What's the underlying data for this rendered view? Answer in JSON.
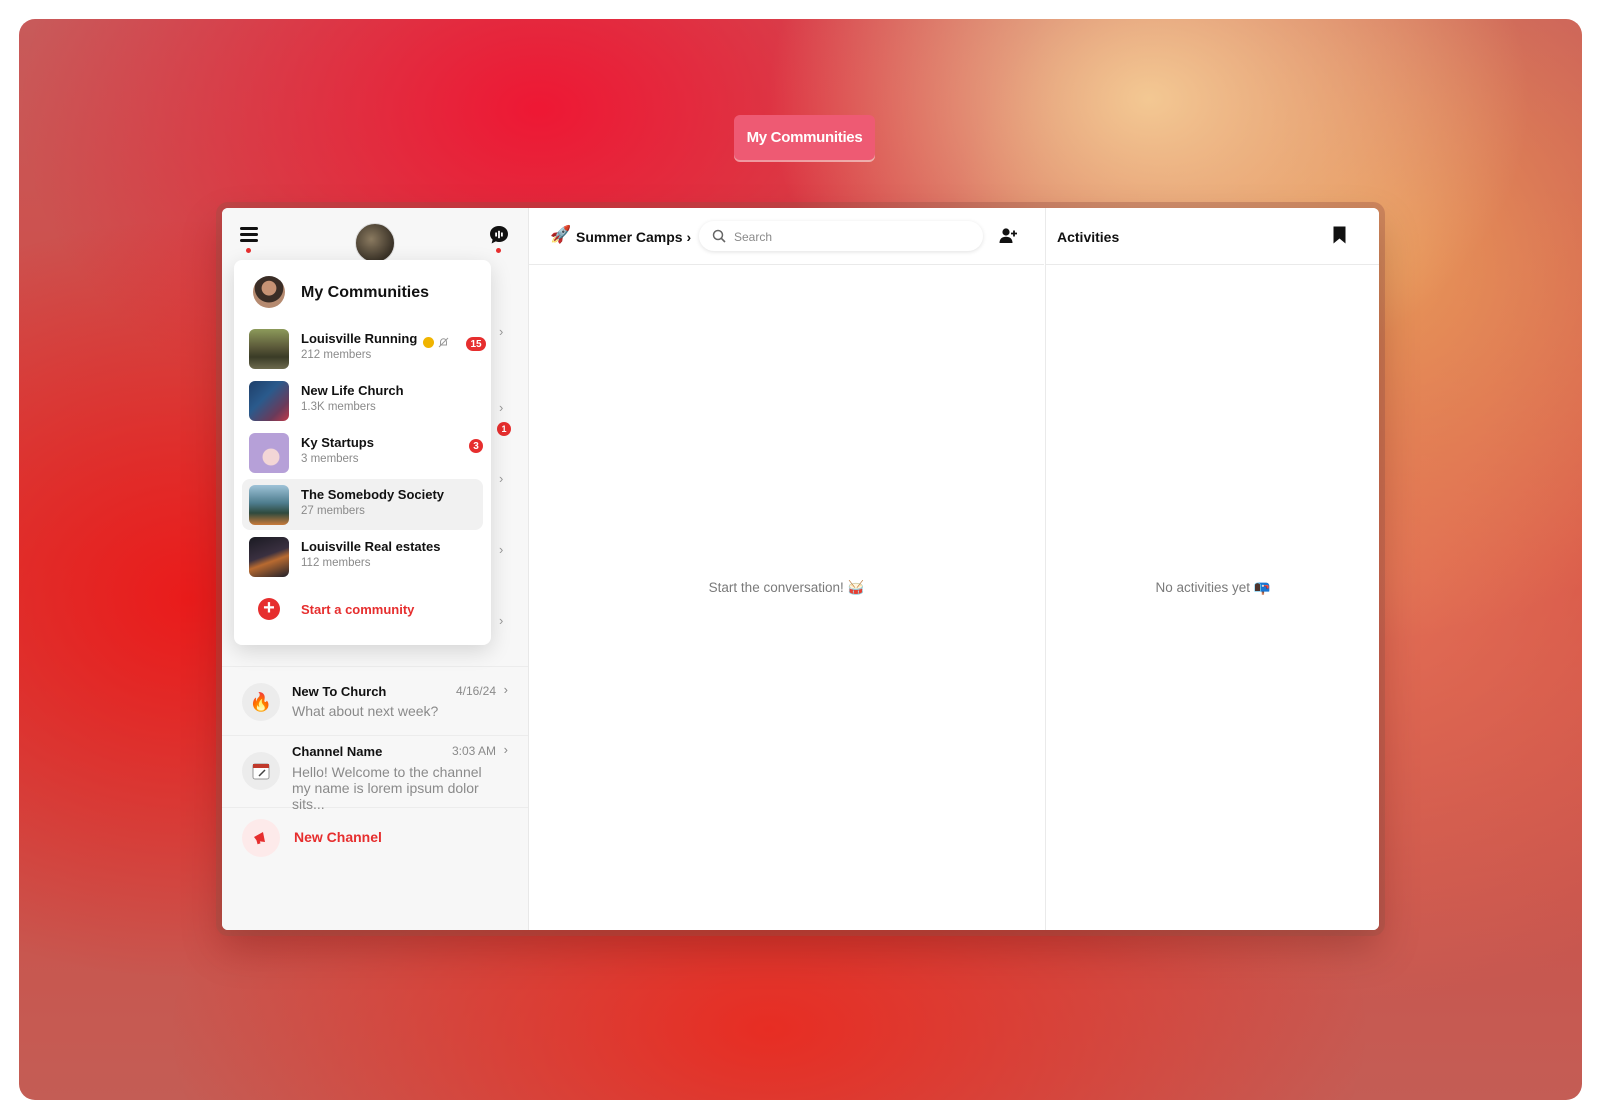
{
  "top_button": {
    "label": "My Communities"
  },
  "sidebar": {
    "channels": [
      {
        "title": "New To Church",
        "time": "4/16/24",
        "preview": "What about next week?",
        "icon": "fire-emoji"
      },
      {
        "title": "Channel Name",
        "time": "3:03 AM",
        "preview": "Hello! Welcome to the channel my name is lorem ipsum dolor sits...",
        "icon": "calendar-icon"
      }
    ],
    "hidden_badge": "1",
    "new_channel_label": "New Channel"
  },
  "dropdown": {
    "title": "My Communities",
    "communities": [
      {
        "name": "Louisville Running",
        "members": "212 members",
        "badge": "15",
        "verified": true,
        "muted": true
      },
      {
        "name": "New Life Church",
        "members": "1.3K members",
        "badge": ""
      },
      {
        "name": "Ky Startups",
        "members": "3 members",
        "badge": "3"
      },
      {
        "name": "The Somebody Society",
        "members": "27 members",
        "badge": "",
        "active": true
      },
      {
        "name": "Louisville Real estates",
        "members": "112 members",
        "badge": ""
      }
    ],
    "start_label": "Start a community"
  },
  "main": {
    "title": "Summer Camps",
    "search": {
      "placeholder": "Search"
    },
    "empty_text": "Start the conversation! 🥁"
  },
  "activities": {
    "title": "Activities",
    "empty_text": "No activities yet 📭"
  },
  "colors": {
    "accent": "#e62e2e",
    "pill": "#ee5a73"
  }
}
